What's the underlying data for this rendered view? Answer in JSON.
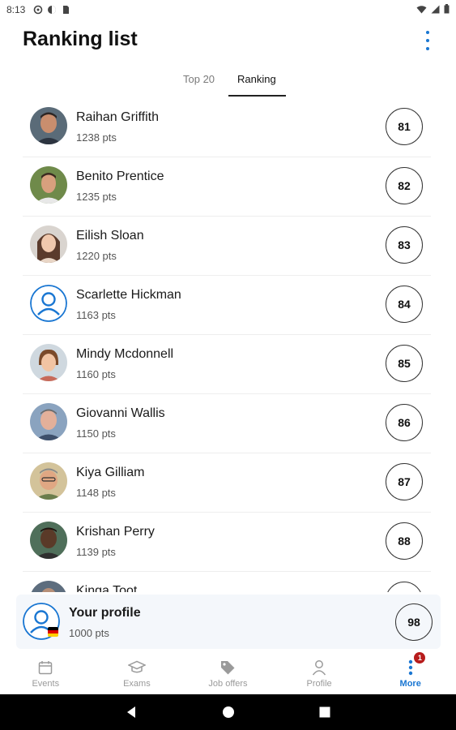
{
  "status_bar": {
    "time": "8:13"
  },
  "app": {
    "title": "Ranking list"
  },
  "tabs": [
    {
      "label": "Top 20"
    },
    {
      "label": "Ranking"
    }
  ],
  "ranking": [
    {
      "name": "Raihan Griffith",
      "points": "1238 pts",
      "rank": "81"
    },
    {
      "name": "Benito Prentice",
      "points": "1235 pts",
      "rank": "82"
    },
    {
      "name": "Eilish Sloan",
      "points": "1220 pts",
      "rank": "83"
    },
    {
      "name": "Scarlette Hickman",
      "points": "1163 pts",
      "rank": "84"
    },
    {
      "name": "Mindy Mcdonnell",
      "points": "1160 pts",
      "rank": "85"
    },
    {
      "name": "Giovanni Wallis",
      "points": "1150 pts",
      "rank": "86"
    },
    {
      "name": "Kiya Gilliam",
      "points": "1148 pts",
      "rank": "87"
    },
    {
      "name": "Krishan Perry",
      "points": "1139 pts",
      "rank": "88"
    },
    {
      "name": "Kinga Toot",
      "points": "",
      "rank": ""
    }
  ],
  "my_profile": {
    "name": "Your profile",
    "points": "1000 pts",
    "rank": "98"
  },
  "bottom_nav": [
    {
      "label": "Events",
      "icon": "calendar-icon"
    },
    {
      "label": "Exams",
      "icon": "graduation-cap-icon"
    },
    {
      "label": "Job offers",
      "icon": "tag-icon"
    },
    {
      "label": "Profile",
      "icon": "person-icon"
    },
    {
      "label": "More",
      "icon": "more-vertical-icon",
      "badge": "1",
      "active": true
    }
  ],
  "colors": {
    "accent": "#1976d2",
    "badge": "#b71c1c",
    "text": "#1a1a1a",
    "secondary_text": "#555555"
  }
}
